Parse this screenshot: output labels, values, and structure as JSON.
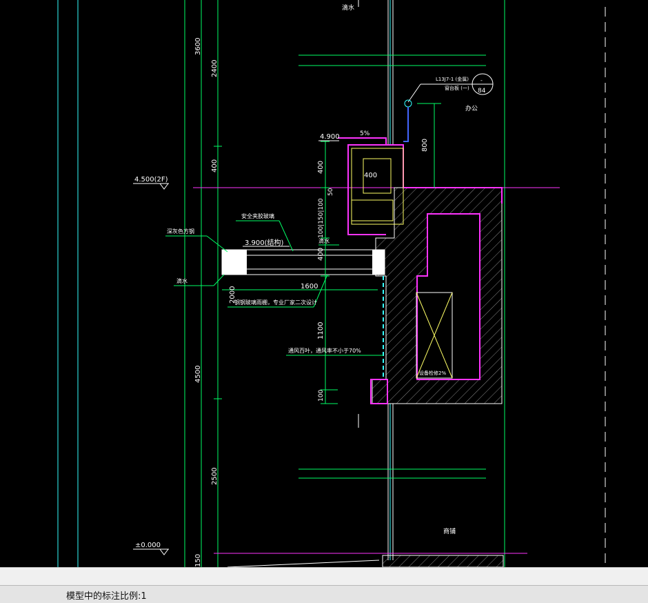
{
  "drawing": {
    "labels": {
      "drain_top": "滴水",
      "ref_code": "L13J7-1 (金属)",
      "ref_sub": "窗台板 (一)",
      "callout_num": "84",
      "callout_dash": "-",
      "office": "办公",
      "slope": "5%",
      "elev_4900": "4.900",
      "elev_4500": "4.500(2F)",
      "safety_glass": "安全夹胶玻璃",
      "steel_tube": "深灰色方钢",
      "elev_3900": "3.900(结构)",
      "drain_left": "滴水",
      "drain_mid": "滴水",
      "canopy_note": "钢钢玻璃雨棚，专业厂家二次设计",
      "louver_note": "通风百叶，通风率不小于70%",
      "equipment": "设备检修2%",
      "shop": "商铺",
      "elev_0": "±0.000"
    },
    "dims": {
      "d3600": "3600",
      "d2400": "2400",
      "d400a": "400",
      "d4500": "4500",
      "d2500": "2500",
      "d150": "150",
      "d400b": "400",
      "d50": "50",
      "d100150100": "100|150|100",
      "d400c": "400",
      "d400w": "400",
      "d800": "800",
      "d2000": "2000",
      "d1600": "1600",
      "d1100": "1100",
      "d100": "100"
    }
  },
  "status": {
    "scale_text": "模型中的标注比例:1"
  },
  "colors": {
    "background": "#000000",
    "green": "#00ff66",
    "cyan": "#33ffff",
    "magenta": "#ff33ff",
    "white": "#ffffff",
    "yellow": "#ffff66"
  }
}
